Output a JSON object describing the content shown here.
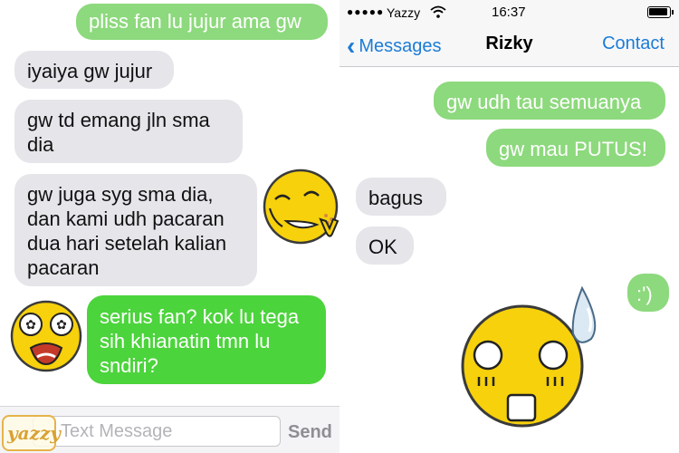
{
  "left_screen": {
    "messages": [
      {
        "side": "outgoing",
        "text": "pliss fan lu jujur ama gw"
      },
      {
        "side": "incoming",
        "text": "iyaiya gw jujur"
      },
      {
        "side": "incoming",
        "text": "gw td emang jln sma dia"
      },
      {
        "side": "incoming",
        "text": "gw juga syg sma dia, dan kami udh pacaran dua hari setelah kalian pacaran"
      },
      {
        "side": "outgoing",
        "text": "serius fan? kok lu tega sih khianatin tmn lu sndiri?"
      }
    ],
    "composer": {
      "placeholder": "Text Message",
      "send_label": "Send"
    },
    "watermark": "yazzy"
  },
  "right_screen": {
    "status_bar": {
      "signal": "●●●●●",
      "carrier": "Yazzy",
      "time": "16:37"
    },
    "nav": {
      "back_label": "Messages",
      "title": "Rizky",
      "contact_label": "Contact"
    },
    "messages": [
      {
        "side": "outgoing",
        "text": "gw udh tau semuanya"
      },
      {
        "side": "outgoing",
        "text": "gw mau PUTUS!"
      },
      {
        "side": "incoming",
        "text": "bagus"
      },
      {
        "side": "incoming",
        "text": "OK"
      },
      {
        "side": "outgoing",
        "text": ":')"
      }
    ]
  },
  "colors": {
    "incoming_bubble": "#e5e5ea",
    "outgoing_bubble": "#8dd97d",
    "outgoing_bubble_strong": "#4cd43c",
    "ios_blue": "#1b7cd6",
    "emoji_yellow": "#f6d10c"
  },
  "icons": [
    "wifi-icon",
    "battery-icon",
    "chevron-left-icon",
    "smug-emoji-sticker",
    "shocked-emoji-sticker",
    "sweating-emoji-sticker"
  ]
}
